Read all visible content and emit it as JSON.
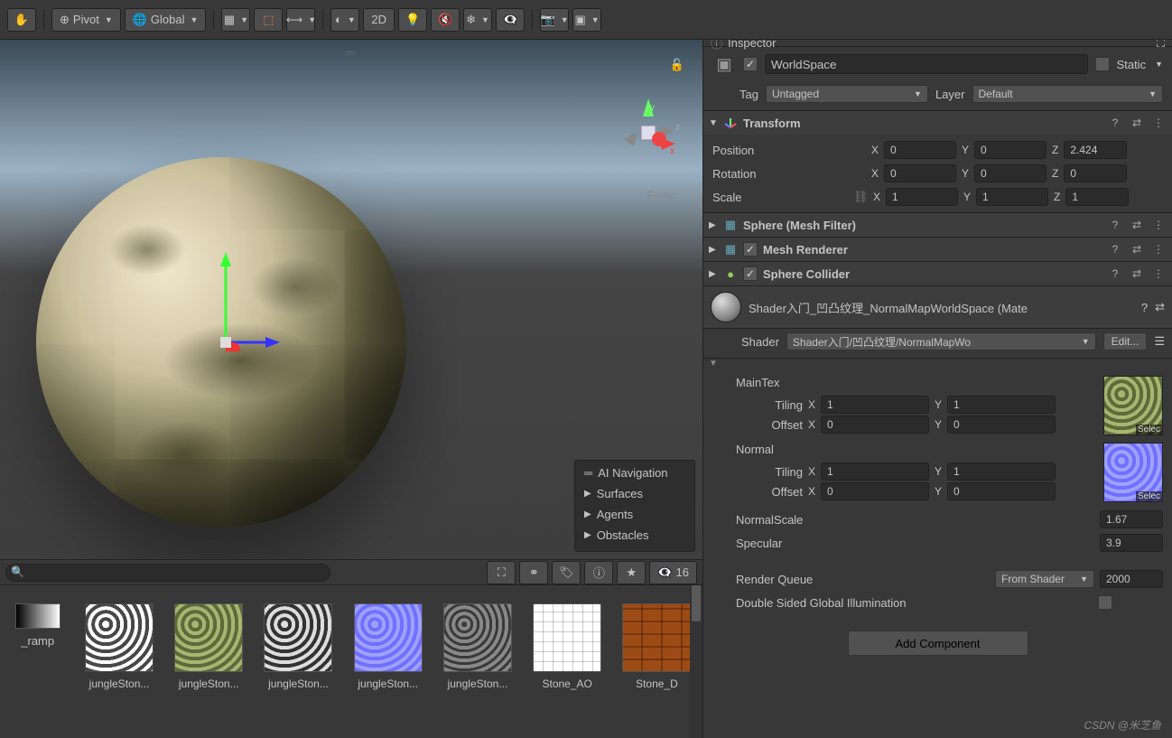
{
  "toolbar": {
    "pivot": "Pivot",
    "global": "Global",
    "mode2d": "2D",
    "eyeCount": "16"
  },
  "scene": {
    "persp": "Persp",
    "aiNav": {
      "title": "AI Navigation",
      "surfaces": "Surfaces",
      "agents": "Agents",
      "obstacles": "Obstacles"
    }
  },
  "project": {
    "assets": [
      {
        "label": "_ramp"
      },
      {
        "label": "jungleSton..."
      },
      {
        "label": "jungleSton..."
      },
      {
        "label": "jungleSton..."
      },
      {
        "label": "jungleSton..."
      },
      {
        "label": "jungleSton..."
      },
      {
        "label": "Stone_AO"
      },
      {
        "label": "Stone_D"
      }
    ]
  },
  "inspector": {
    "tab": "Inspector",
    "name": "WorldSpace",
    "static": "Static",
    "tagLabel": "Tag",
    "tag": "Untagged",
    "layerLabel": "Layer",
    "layer": "Default",
    "transform": {
      "title": "Transform",
      "position": "Position",
      "rotation": "Rotation",
      "scale": "Scale",
      "pos": {
        "x": "0",
        "y": "0",
        "z": "2.424"
      },
      "rot": {
        "x": "0",
        "y": "0",
        "z": "0"
      },
      "scl": {
        "x": "1",
        "y": "1",
        "z": "1"
      }
    },
    "components": {
      "sphere": "Sphere (Mesh Filter)",
      "meshRenderer": "Mesh Renderer",
      "sphereCollider": "Sphere Collider"
    },
    "material": {
      "name": "Shader入门_凹凸纹理_NormalMapWorldSpace (Mate",
      "shaderLabel": "Shader",
      "shader": "Shader入门/凹凸纹理/NormalMapWo",
      "edit": "Edit...",
      "mainTex": "MainTex",
      "normal": "Normal",
      "tiling": "Tiling",
      "offset": "Offset",
      "maintexTiling": {
        "x": "1",
        "y": "1"
      },
      "maintexOffset": {
        "x": "0",
        "y": "0"
      },
      "normalTiling": {
        "x": "1",
        "y": "1"
      },
      "normalOffset": {
        "x": "0",
        "y": "0"
      },
      "normalScaleLabel": "NormalScale",
      "normalScale": "1.67",
      "specularLabel": "Specular",
      "specular": "3.9",
      "renderQueueLabel": "Render Queue",
      "renderQueueMode": "From Shader",
      "renderQueue": "2000",
      "doubleSided": "Double Sided Global Illumination",
      "select": "Selec"
    },
    "addComponent": "Add Component"
  },
  "watermark": "CSDN @米芝鱼"
}
